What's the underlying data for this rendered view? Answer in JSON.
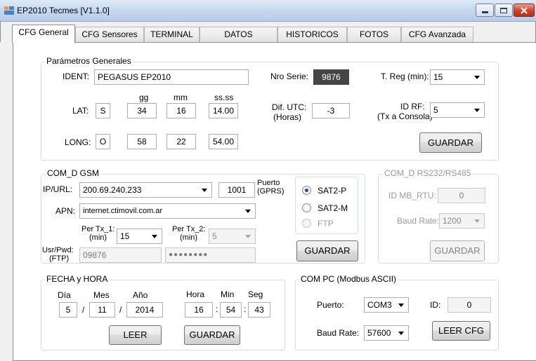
{
  "window": {
    "title": "EP2010 Tecmes  [V1.1.0]"
  },
  "tabs": [
    "CFG General",
    "CFG Sensores",
    "TERMINAL",
    "DATOS",
    "HISTORICOS",
    "FOTOS",
    "CFG Avanzada"
  ],
  "parametros": {
    "legend": "Parámetros Generales",
    "ident_label": "IDENT:",
    "ident_value": "PEGASUS EP2010",
    "nro_serie_label": "Nro Serie:",
    "nro_serie_value": "9876",
    "treg_label": "T. Reg (min):",
    "treg_value": "15",
    "col_gg": "gg",
    "col_mm": "mm",
    "col_ss": "ss.ss",
    "lat_label": "LAT:",
    "lat_hem": "S",
    "lat_gg": "34",
    "lat_mm": "16",
    "lat_ss": "14.00",
    "long_label": "LONG:",
    "long_hem": "O",
    "long_gg": "58",
    "long_mm": "22",
    "long_ss": "54.00",
    "dif_utc_label": "Dif. UTC:",
    "dif_utc_sub": "(Horas)",
    "dif_utc_value": "-3",
    "id_rf_label": "ID RF:",
    "id_rf_sub": "(Tx a Consola)",
    "id_rf_value": "5",
    "guardar": "GUARDAR"
  },
  "gsm": {
    "legend": "COM_D  GSM",
    "ipurl_label": "IP/URL:",
    "ipurl_value": "200.69.240.233",
    "puerto_value": "1001",
    "puerto_label": "Puerto",
    "puerto_sub": "(GPRS)",
    "apn_label": "APN:",
    "apn_value": "internet.ctimovil.com.ar",
    "pertx1_label": "Per Tx_1:",
    "pertx1_sub": "(min)",
    "pertx1_value": "15",
    "pertx2_label": "Per Tx_2:",
    "pertx2_sub": "(min)",
    "pertx2_value": "5",
    "usr_label": "Usr/Pwd:",
    "usr_sub": "(FTP)",
    "usr_value": "09876",
    "pwd_value": "●●●●●●●●",
    "radios": [
      "SAT2-P",
      "SAT2-M",
      "FTP"
    ],
    "guardar": "GUARDAR"
  },
  "rs232": {
    "legend": "COM_D RS232/RS485",
    "idmb_label": "ID MB_RTU:",
    "idmb_value": "0",
    "baud_label": "Baud Rate:",
    "baud_value": "1200",
    "guardar": "GUARDAR"
  },
  "fecha": {
    "legend": "FECHA y HORA",
    "dia_label": "Día",
    "mes_label": "Mes",
    "ano_label": "Año",
    "hora_label": "Hora",
    "min_label": "Min",
    "seg_label": "Seg",
    "dia": "5",
    "mes": "11",
    "ano": "2014",
    "hora": "16",
    "min": "54",
    "seg": "43",
    "slash": "/",
    "colon": ":",
    "leer": "LEER",
    "guardar": "GUARDAR"
  },
  "compc": {
    "legend": "COM PC (Modbus ASCII)",
    "puerto_label": "Puerto:",
    "puerto_value": "COM3",
    "id_label": "ID:",
    "id_value": "0",
    "baud_label": "Baud Rate:",
    "baud_value": "57600",
    "leer_cfg": "LEER CFG"
  }
}
